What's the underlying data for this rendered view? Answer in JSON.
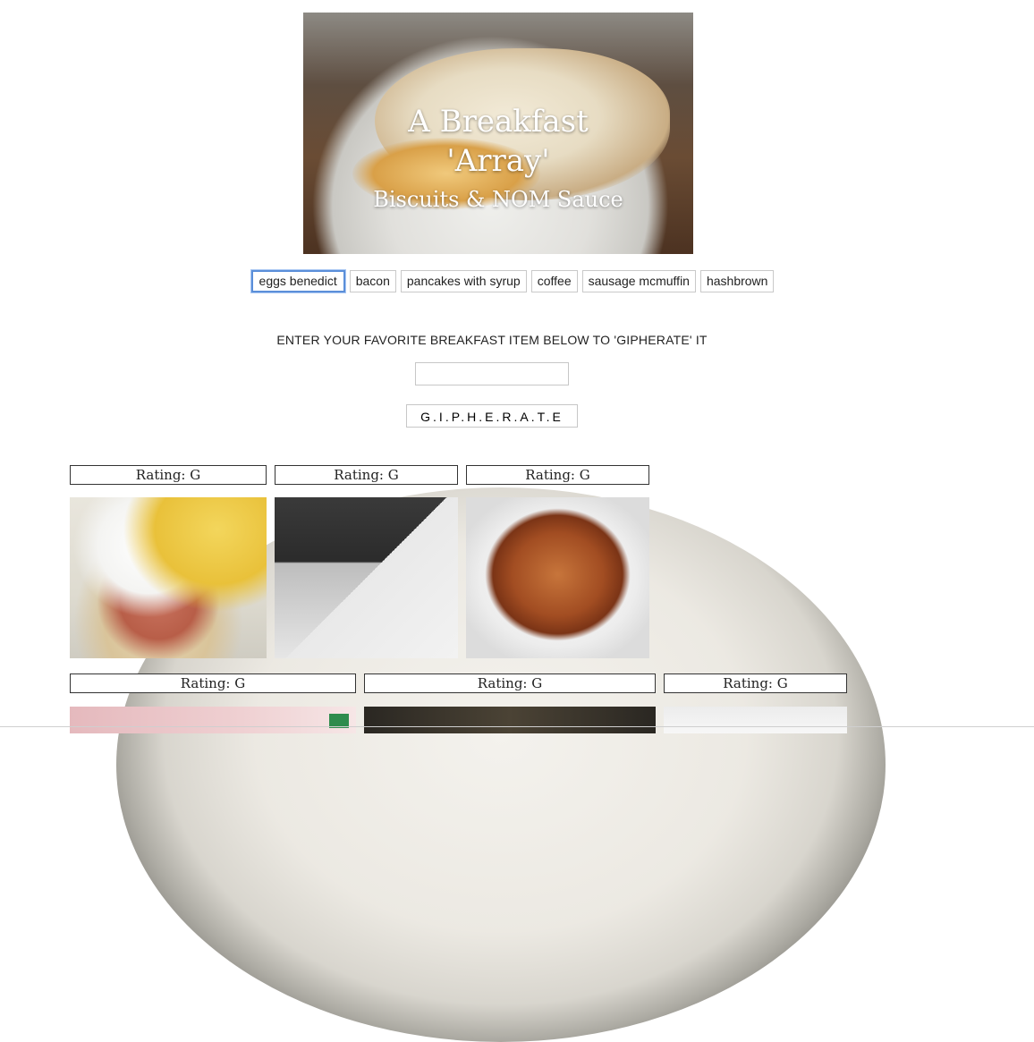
{
  "hero": {
    "title_line1": "A Breakfast",
    "title_line2": "'Array'",
    "subtitle": "Biscuits & NOM Sauce"
  },
  "food_buttons": [
    {
      "label": "eggs benedict",
      "active": true
    },
    {
      "label": "bacon"
    },
    {
      "label": "pancakes with syrup"
    },
    {
      "label": "coffee"
    },
    {
      "label": "sausage mcmuffin"
    },
    {
      "label": "hashbrown"
    }
  ],
  "form": {
    "prompt": "ENTER YOUR FAVORITE BREAKFAST ITEM BELOW TO 'GIPHERATE' IT",
    "input_value": "",
    "submit_label": "G.I.P.H.E.R.A.T.E"
  },
  "gifs": [
    {
      "rating": "Rating: G"
    },
    {
      "rating": "Rating: G"
    },
    {
      "rating": "Rating: G"
    },
    {
      "rating": "Rating: G"
    },
    {
      "rating": "Rating: G"
    },
    {
      "rating": "Rating: G"
    }
  ],
  "colors": {
    "focus_ring": "#5b8fd9",
    "border": "#c7c7c7"
  }
}
